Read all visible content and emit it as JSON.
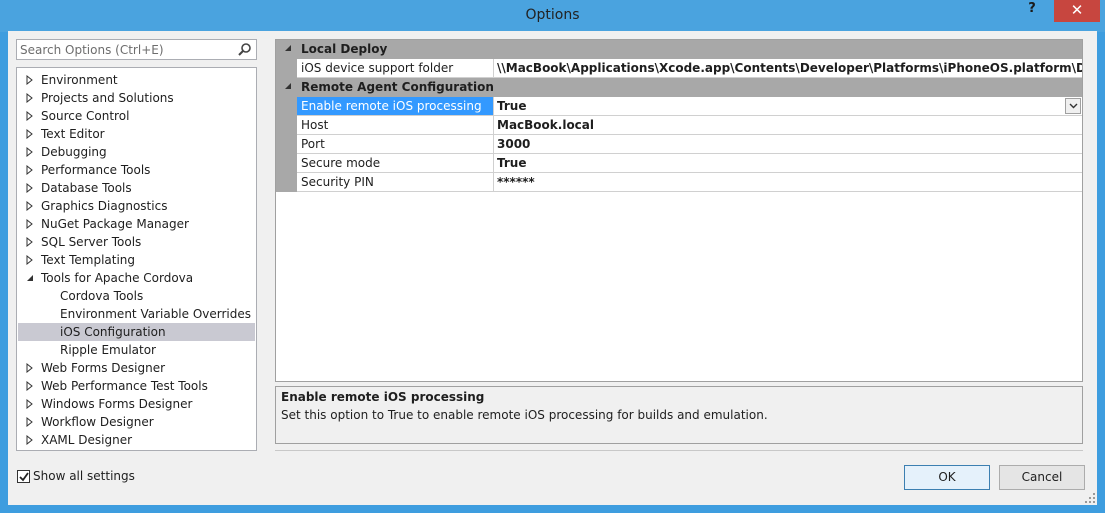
{
  "window": {
    "title": "Options",
    "help_label": "?",
    "close_label": "✕"
  },
  "search": {
    "placeholder": "Search Options (Ctrl+E)"
  },
  "tree": {
    "items": [
      {
        "label": "Environment",
        "level": 0,
        "expanded": false
      },
      {
        "label": "Projects and Solutions",
        "level": 0,
        "expanded": false
      },
      {
        "label": "Source Control",
        "level": 0,
        "expanded": false
      },
      {
        "label": "Text Editor",
        "level": 0,
        "expanded": false
      },
      {
        "label": "Debugging",
        "level": 0,
        "expanded": false
      },
      {
        "label": "Performance Tools",
        "level": 0,
        "expanded": false
      },
      {
        "label": "Database Tools",
        "level": 0,
        "expanded": false
      },
      {
        "label": "Graphics Diagnostics",
        "level": 0,
        "expanded": false
      },
      {
        "label": "NuGet Package Manager",
        "level": 0,
        "expanded": false
      },
      {
        "label": "SQL Server Tools",
        "level": 0,
        "expanded": false
      },
      {
        "label": "Text Templating",
        "level": 0,
        "expanded": false
      },
      {
        "label": "Tools for Apache Cordova",
        "level": 0,
        "expanded": true
      },
      {
        "label": "Cordova Tools",
        "level": 1
      },
      {
        "label": "Environment Variable Overrides",
        "level": 1
      },
      {
        "label": "iOS Configuration",
        "level": 1,
        "selected": true
      },
      {
        "label": "Ripple Emulator",
        "level": 1
      },
      {
        "label": "Web Forms Designer",
        "level": 0,
        "expanded": false
      },
      {
        "label": "Web Performance Test Tools",
        "level": 0,
        "expanded": false
      },
      {
        "label": "Windows Forms Designer",
        "level": 0,
        "expanded": false
      },
      {
        "label": "Workflow Designer",
        "level": 0,
        "expanded": false
      },
      {
        "label": "XAML Designer",
        "level": 0,
        "expanded": false
      }
    ]
  },
  "grid": {
    "categories": [
      {
        "label": "Local Deploy",
        "properties": [
          {
            "name": "iOS device support folder",
            "value": "\\\\MacBook\\Applications\\Xcode.app\\Contents\\Developer\\Platforms\\iPhoneOS.platform\\DeviceSupport"
          }
        ]
      },
      {
        "label": "Remote Agent Configuration",
        "properties": [
          {
            "name": "Enable remote iOS processing",
            "value": "True",
            "selected": true
          },
          {
            "name": "Host",
            "value": "MacBook.local"
          },
          {
            "name": "Port",
            "value": "3000"
          },
          {
            "name": "Secure mode",
            "value": "True"
          },
          {
            "name": "Security PIN",
            "value": "******"
          }
        ]
      }
    ]
  },
  "description": {
    "title": "Enable remote iOS processing",
    "text": "Set this option to True to enable remote iOS processing for builds and emulation."
  },
  "footer": {
    "show_all_settings_label": "Show all settings",
    "show_all_settings_checked": true,
    "ok_label": "OK",
    "cancel_label": "Cancel"
  },
  "colors": {
    "accent": "#3e9ddf",
    "selection": "#3399ff",
    "close": "#c7463f"
  }
}
